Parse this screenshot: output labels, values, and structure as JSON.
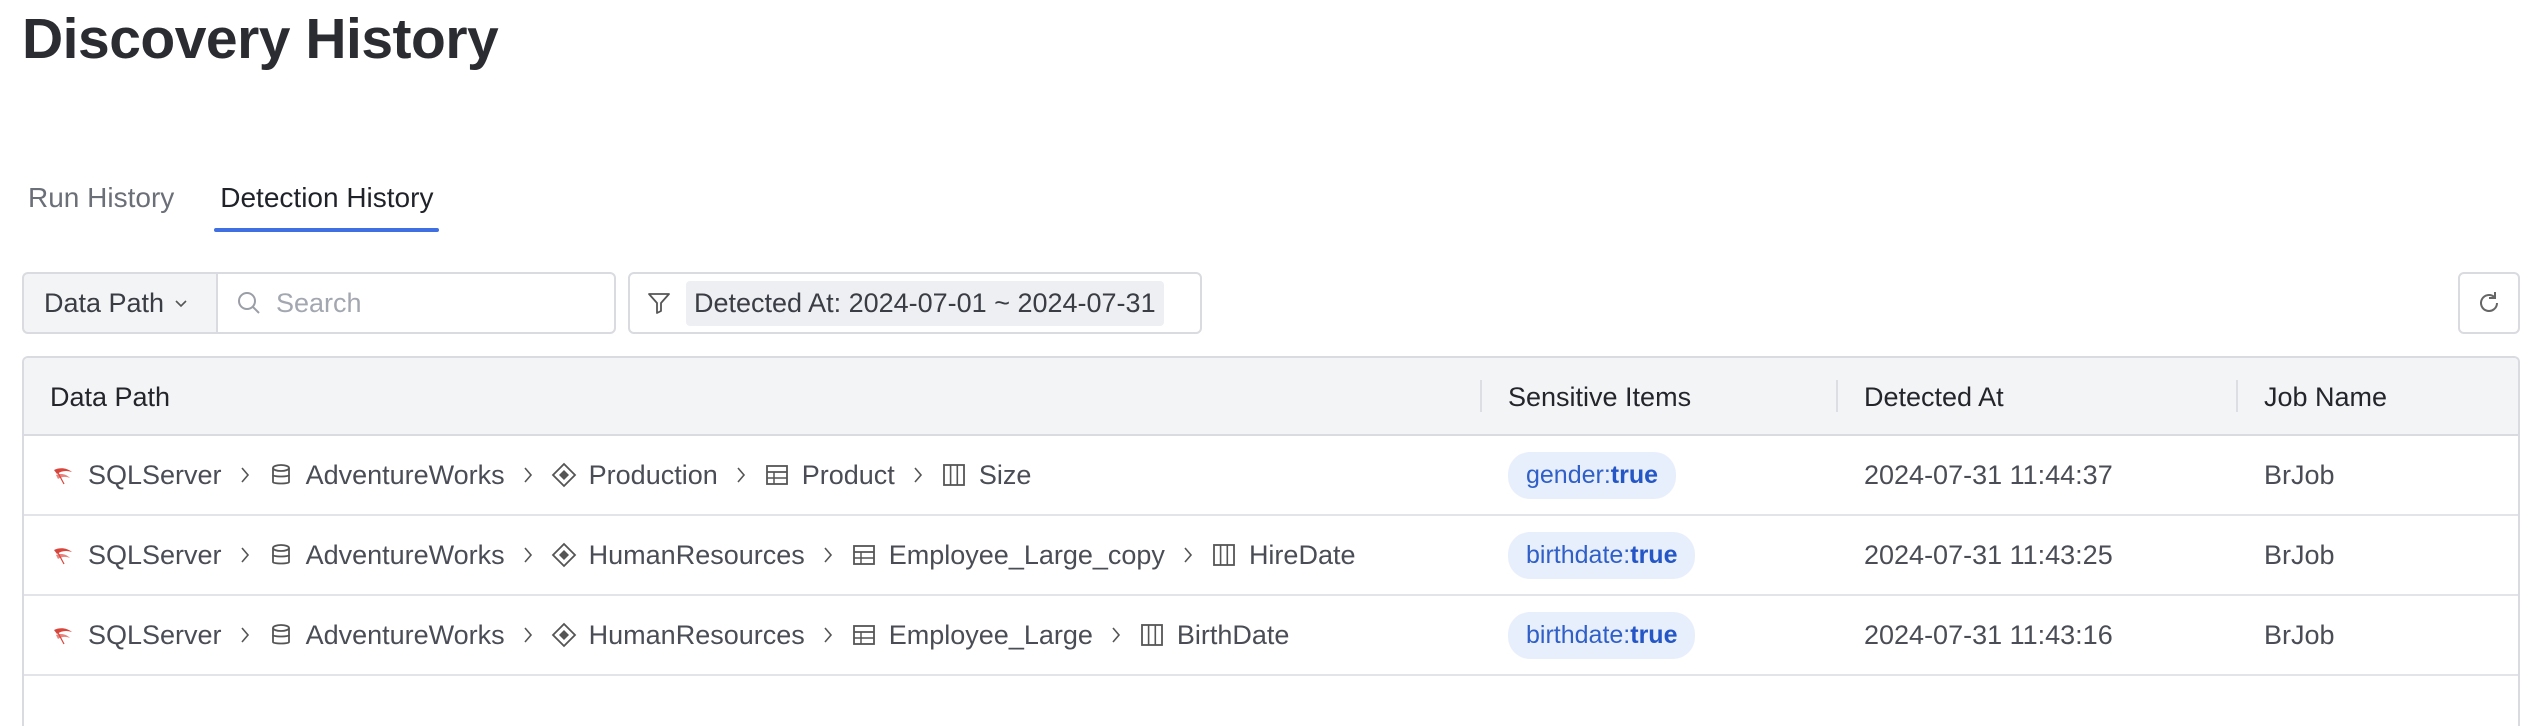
{
  "page": {
    "title": "Discovery History"
  },
  "tabs": [
    {
      "label": "Run History",
      "active": false
    },
    {
      "label": "Detection History",
      "active": true
    }
  ],
  "toolbar": {
    "path_select_label": "Data Path",
    "search_placeholder": "Search",
    "filter_label": "Detected At: 2024-07-01 ~ 2024-07-31"
  },
  "table": {
    "columns": {
      "data_path": "Data Path",
      "sensitive_items": "Sensitive Items",
      "detected_at": "Detected At",
      "job_name": "Job Name"
    },
    "rows": [
      {
        "path": [
          "SQLServer",
          "AdventureWorks",
          "Production",
          "Product",
          "Size"
        ],
        "sensitive_key": "gender:",
        "sensitive_val": "true",
        "detected_at": "2024-07-31 11:44:37",
        "job_name": "BrJob"
      },
      {
        "path": [
          "SQLServer",
          "AdventureWorks",
          "HumanResources",
          "Employee_Large_copy",
          "HireDate"
        ],
        "sensitive_key": "birthdate:",
        "sensitive_val": "true",
        "detected_at": "2024-07-31 11:43:25",
        "job_name": "BrJob"
      },
      {
        "path": [
          "SQLServer",
          "AdventureWorks",
          "HumanResources",
          "Employee_Large",
          "BirthDate"
        ],
        "sensitive_key": "birthdate:",
        "sensitive_val": "true",
        "detected_at": "2024-07-31 11:43:16",
        "job_name": "BrJob"
      }
    ]
  },
  "icons": {
    "path_levels": [
      "sqlserver-icon",
      "database-icon",
      "schema-icon",
      "table-icon",
      "column-icon"
    ]
  },
  "colors": {
    "accent": "#3f6fe0",
    "badge_bg": "#e8effc",
    "badge_text": "#2456c6",
    "sqlserver_red": "#d8453b"
  }
}
